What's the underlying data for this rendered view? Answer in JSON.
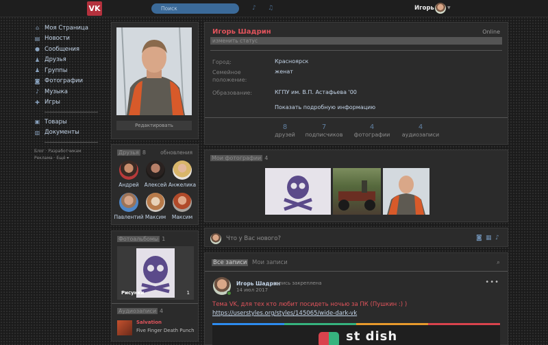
{
  "topbar": {
    "search_placeholder": "Поиск",
    "user_name": "Игорь"
  },
  "nav": {
    "items": [
      {
        "label": "Моя Страница",
        "icon": "home-icon"
      },
      {
        "label": "Новости",
        "icon": "news-icon"
      },
      {
        "label": "Сообщения",
        "icon": "messages-icon"
      },
      {
        "label": "Друзья",
        "icon": "friends-icon"
      },
      {
        "label": "Группы",
        "icon": "groups-icon"
      },
      {
        "label": "Фотографии",
        "icon": "camera-icon"
      },
      {
        "label": "Музыка",
        "icon": "music-icon"
      },
      {
        "label": "Игры",
        "icon": "games-icon"
      }
    ],
    "items2": [
      {
        "label": "Товары",
        "icon": "shop-icon"
      },
      {
        "label": "Документы",
        "icon": "documents-icon"
      }
    ],
    "footer": [
      "Блог",
      "Разработчикам",
      "Реклама",
      "Ещё"
    ]
  },
  "profile": {
    "edit_label": "Редактировать",
    "name": "Игорь Шадрин",
    "online": "Online",
    "status": "изменить статус",
    "info": [
      {
        "label": "Город:",
        "value": "Красноярск"
      },
      {
        "label": "Семейное положение:",
        "value": "женат"
      },
      {
        "label": "Образование:",
        "value": "КГПУ им. В.П. Астафьева '00"
      }
    ],
    "more_info": "Показать подробную информацию",
    "counters": [
      {
        "num": "8",
        "label": "друзей"
      },
      {
        "num": "7",
        "label": "подписчиков"
      },
      {
        "num": "4",
        "label": "фотографии"
      },
      {
        "num": "4",
        "label": "аудиозаписи"
      }
    ]
  },
  "friends": {
    "title": "Друзья",
    "count": "8",
    "updates": "обновления",
    "list": [
      "Андрей",
      "Алексей",
      "Анжелика",
      "Павлентий",
      "Максим",
      "Максим"
    ]
  },
  "photos": {
    "title": "Мои фотографии",
    "count": "4"
  },
  "albums": {
    "title": "Фотоальбомы",
    "count": "1",
    "album_name": "Рисунки",
    "album_count": "1"
  },
  "audio": {
    "title": "Аудиозаписи",
    "count": "4",
    "track_title": "Salvation",
    "track_artist": "Five Finger Death Punch"
  },
  "post_box": {
    "placeholder": "Что у Вас нового?"
  },
  "wall": {
    "tabs": [
      "Все записи",
      "Мои записи"
    ],
    "post": {
      "author": "Игорь Шадрин",
      "pinned": "запись закреплена",
      "date": "14 июл 2017",
      "text": "Тема VK, для тех кто любит посидеть ночью за ПК (Пушкин :) )",
      "link": "https://userstyles.org/styles/145065/wide-dark-vk",
      "image_text": "st dish"
    }
  },
  "colors": {
    "accent_red": "#e2545c",
    "link_blue": "#c5d6ea",
    "logo_red": "#b4313d"
  }
}
